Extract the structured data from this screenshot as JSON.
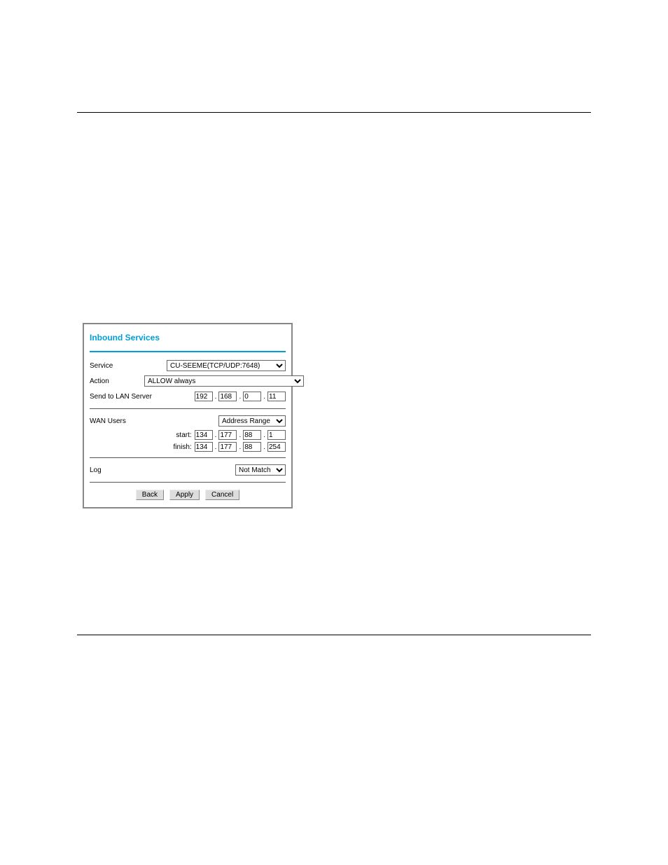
{
  "panel": {
    "title": "Inbound Services",
    "rows": {
      "service": {
        "label": "Service",
        "value": "CU-SEEME(TCP/UDP:7648)"
      },
      "action": {
        "label": "Action",
        "value": "ALLOW always"
      },
      "send_to_lan": {
        "label": "Send to LAN Server",
        "ip": [
          "192",
          "168",
          "0",
          "11"
        ]
      },
      "wan_users": {
        "label": "WAN Users",
        "mode": "Address Range",
        "start_label": "start:",
        "start": [
          "134",
          "177",
          "88",
          "1"
        ],
        "finish_label": "finish:",
        "finish": [
          "134",
          "177",
          "88",
          "254"
        ]
      },
      "log": {
        "label": "Log",
        "value": "Not Match"
      }
    },
    "buttons": {
      "back": "Back",
      "apply": "Apply",
      "cancel": "Cancel"
    }
  }
}
